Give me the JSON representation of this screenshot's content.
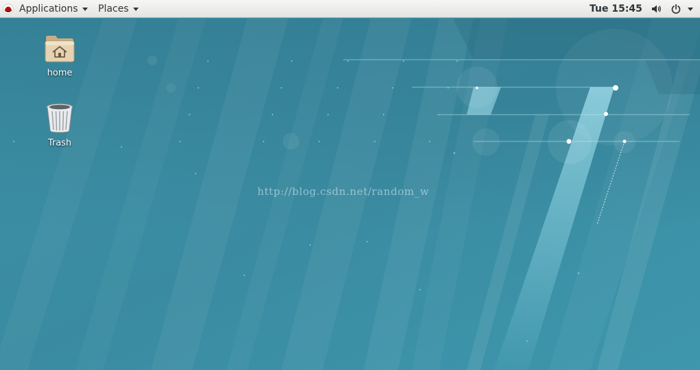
{
  "topbar": {
    "logo_icon": "redhat-logo-icon",
    "applications_label": "Applications",
    "places_label": "Places",
    "clock": "Tue 15:45",
    "sound_icon": "volume-icon",
    "power_icon": "power-icon",
    "menu_icon": "chevron-down-icon"
  },
  "desktop": {
    "icons": [
      {
        "label": "home",
        "icon": "folder-home-icon"
      },
      {
        "label": "Trash",
        "icon": "trash-icon"
      }
    ],
    "watermark": "http://blog.csdn.net/random_w"
  },
  "colors": {
    "topbar_bg": "#ececea",
    "wallpaper_base": "#3a8ea5",
    "accent_light": "#8fd6e6"
  }
}
